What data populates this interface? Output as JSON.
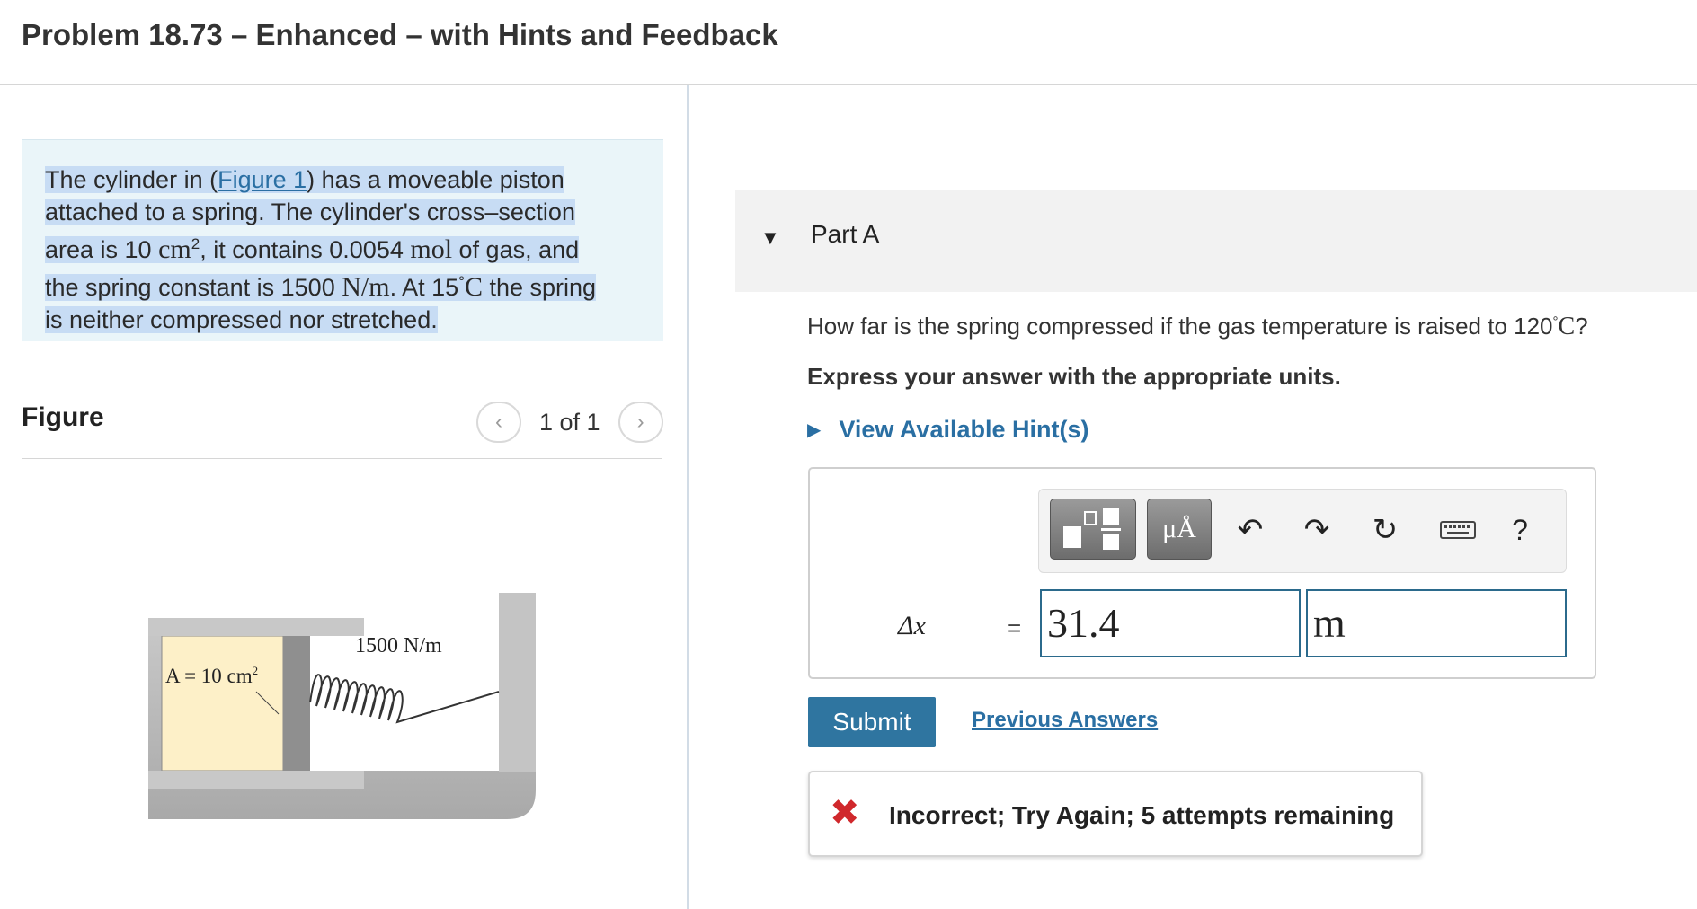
{
  "header": {
    "title": "Problem 18.73 – Enhanced – with Hints and Feedback"
  },
  "intro": {
    "line1_pre": "The cylinder in (",
    "figure_link": "Figure 1",
    "line1_post": ") has a moveable piston",
    "line2": "attached to a spring. The cylinder's cross–section",
    "line3_pre": "area is 10 ",
    "unit_cm": "cm",
    "exp2": "2",
    "line3_mid": ", it contains 0.0054 ",
    "unit_mol": "mol",
    "line3_post": " of gas, and",
    "line4_pre": "the spring constant is 1500 ",
    "unit_nm": "N/m",
    "line4_mid": ". At 15",
    "deg": "°",
    "unit_c": "C",
    "line4_post": " the spring",
    "line5": "is neither compressed nor stretched."
  },
  "figure": {
    "title": "Figure",
    "prev_icon": "chevron-left-icon",
    "next_icon": "chevron-right-icon",
    "counter": "1 of 1",
    "spring_label": "1500 N/m",
    "area_label": "A = 10 cm",
    "area_exp": "2"
  },
  "part": {
    "caret_icon": "caret-down-icon",
    "label": "Part A"
  },
  "question": {
    "text_pre": "How far is the spring compressed if the gas temperature is raised to 120",
    "deg": "°",
    "unit": "C",
    "text_post": "?",
    "instruction": "Express your answer with the appropriate units.",
    "hints_label": "View Available Hint(s)"
  },
  "toolbar": {
    "templates_icon": "templates-icon",
    "units_label": "μÅ",
    "undo_icon": "undo-icon",
    "redo_icon": "redo-icon",
    "reset_icon": "reset-icon",
    "keyboard_icon": "keyboard-icon",
    "help_label": "?"
  },
  "answer": {
    "variable": "Δx",
    "equals": "=",
    "value": "31.4",
    "unit": "m"
  },
  "actions": {
    "submit_label": "Submit",
    "previous_answers_label": "Previous Answers"
  },
  "feedback": {
    "icon": "x-icon",
    "text": "Incorrect; Try Again; 5 attempts remaining",
    "color": "#d0282c"
  }
}
